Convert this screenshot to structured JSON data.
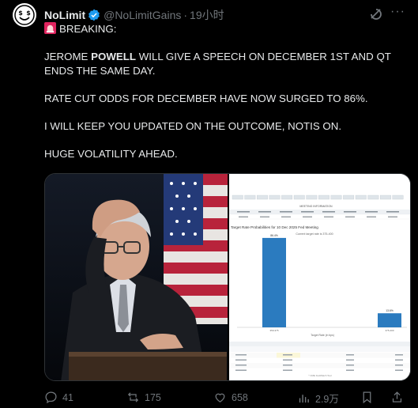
{
  "author": {
    "display_name": "NoLimit",
    "handle": "@NoLimitGains",
    "dot": "·",
    "time": "19小时"
  },
  "post": {
    "breaking": "BREAKING:",
    "line1_part1": "JEROME ",
    "line1_bold": "POWELL",
    "line1_part2": " WILL GIVE A SPEECH ON DECEMBER 1ST AND QT ENDS THE SAME DAY.",
    "line2": "RATE CUT ODDS FOR DECEMBER HAVE NOW SURGED TO 86%.",
    "line3": "I WILL KEEP YOU UPDATED ON THE OUTCOME, NOTIS ON.",
    "line4": "HUGE VOLATILITY AHEAD."
  },
  "doc": {
    "chart_title": "Target Rate Probabilities for 10 Dec 2025 Fed Meeting",
    "subtitle": "Current target rate is 375-400",
    "section_title": "MEETING INFORMATION",
    "x_axis_label": "Target Rate (in bps)",
    "bar1_label": "86.4%",
    "bar1_tick": "350-375",
    "bar2_label": "13.6%",
    "bar2_tick": "375-400",
    "bar1_value": 86.4,
    "bar2_value": 13.6,
    "footer_note": "* CME FedWatch Tool"
  },
  "actions": {
    "replies": "41",
    "reposts": "175",
    "likes": "658",
    "views": "2.9万"
  },
  "colors": {
    "bar": "#2b7bbf",
    "verified": "#1d9bf0",
    "muted": "#71767b"
  }
}
